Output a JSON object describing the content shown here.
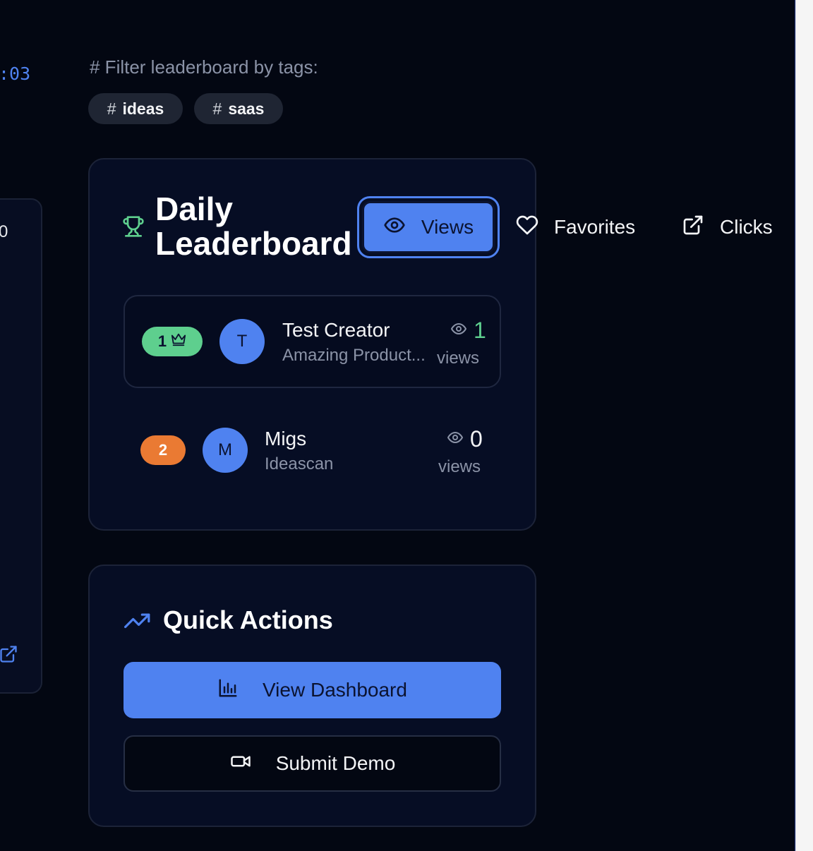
{
  "left_panel": {
    "timer": ":03",
    "card_value": "0"
  },
  "filter": {
    "label": "# Filter leaderboard by tags:",
    "tags": [
      {
        "hash": "#",
        "label": "ideas"
      },
      {
        "hash": "#",
        "label": "saas"
      }
    ]
  },
  "leaderboard": {
    "title": "Daily Leaderboard",
    "metrics": [
      {
        "label": "Views",
        "icon": "eye-icon",
        "selected": true
      },
      {
        "label": "Favorites",
        "icon": "heart-icon",
        "selected": false
      },
      {
        "label": "Clicks",
        "icon": "external-link-icon",
        "selected": false
      }
    ],
    "entries": [
      {
        "rank": "1",
        "rank_icon": "crown-icon",
        "avatar": "T",
        "name": "Test Creator",
        "product": "Amazing Product...",
        "count": "1",
        "count_label": "views"
      },
      {
        "rank": "2",
        "avatar": "M",
        "name": "Migs",
        "product": "Ideascan",
        "count": "0",
        "count_label": "views"
      }
    ]
  },
  "quick_actions": {
    "title": "Quick Actions",
    "primary": "View Dashboard",
    "secondary": "Submit Demo"
  },
  "colors": {
    "background": "#030712",
    "card": "#060d24",
    "accent": "#4f82f0",
    "rank1": "#5ecf8e",
    "rank2": "#ea7a33",
    "muted": "#8b93a7"
  }
}
